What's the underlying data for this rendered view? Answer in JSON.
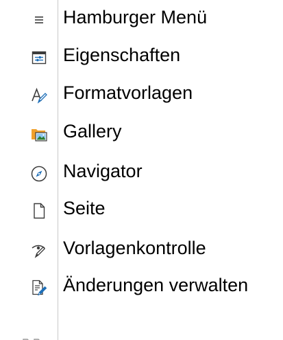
{
  "sidebar": {
    "items": [
      {
        "label": "Hamburger Menü",
        "icon": "hamburger-menu-icon"
      },
      {
        "label": "Eigenschaften",
        "icon": "properties-icon"
      },
      {
        "label": "Formatvorlagen",
        "icon": "styles-icon"
      },
      {
        "label": "Gallery",
        "icon": "gallery-icon"
      },
      {
        "label": "Navigator",
        "icon": "navigator-compass-icon"
      },
      {
        "label": "Seite",
        "icon": "page-icon"
      },
      {
        "label": "Vorlagenkontrolle",
        "icon": "style-inspector-icon"
      },
      {
        "label": "Änderungen verwalten",
        "icon": "manage-changes-icon"
      }
    ]
  },
  "colors": {
    "icon_stroke": "#3b3b3b",
    "icon_accent": "#1e6fb8",
    "folder_orange": "#f0a02b",
    "border": "#c9c9c9"
  }
}
